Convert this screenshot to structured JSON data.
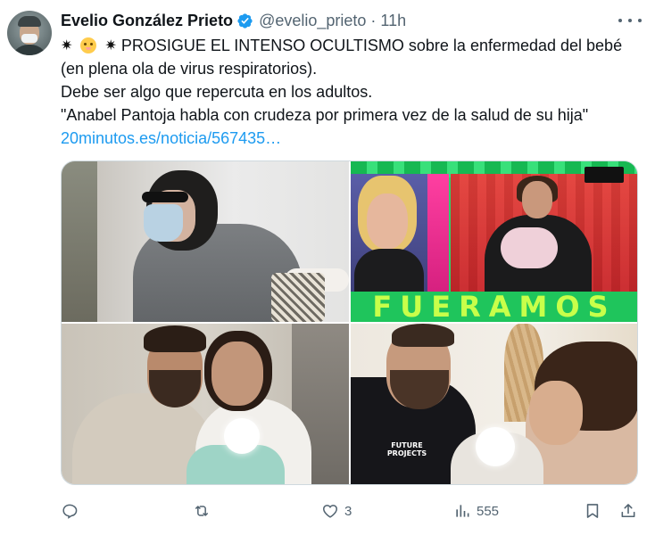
{
  "tweet": {
    "author_name": "Evelio González Prieto",
    "handle": "@evelio_prieto",
    "separator": "·",
    "time": "11h",
    "text_line1": " PROSIGUE EL INTENSO OCULTISMO sobre la enfermedad del bebé",
    "text_line2": "(en plena ola de virus respiratorios).",
    "text_line3": "Debe ser algo que repercuta en los adultos.",
    "text_line4": "\"Anabel Pantoja habla con crudeza por primera vez de la salud de su hija\"",
    "link_text": "20minutos.es/noticia/567435…",
    "emoji_burst": "✷",
    "photos": [
      {
        "overlay_text": ""
      },
      {
        "overlay_text": "FUERAMOS"
      },
      {
        "overlay_text": ""
      },
      {
        "overlay_text": "FUTURE PROJECTS"
      }
    ],
    "actions": {
      "reply_count": "",
      "retweet_count": "",
      "like_count": "3",
      "views_count": "555"
    }
  },
  "icons": [
    "verified-badge-icon",
    "more-icon",
    "reply-icon",
    "retweet-icon",
    "like-icon",
    "views-icon",
    "bookmark-icon",
    "share-icon"
  ],
  "colors": {
    "accent": "#1d9bf0",
    "text": "#0f1419",
    "muted": "#536471"
  }
}
